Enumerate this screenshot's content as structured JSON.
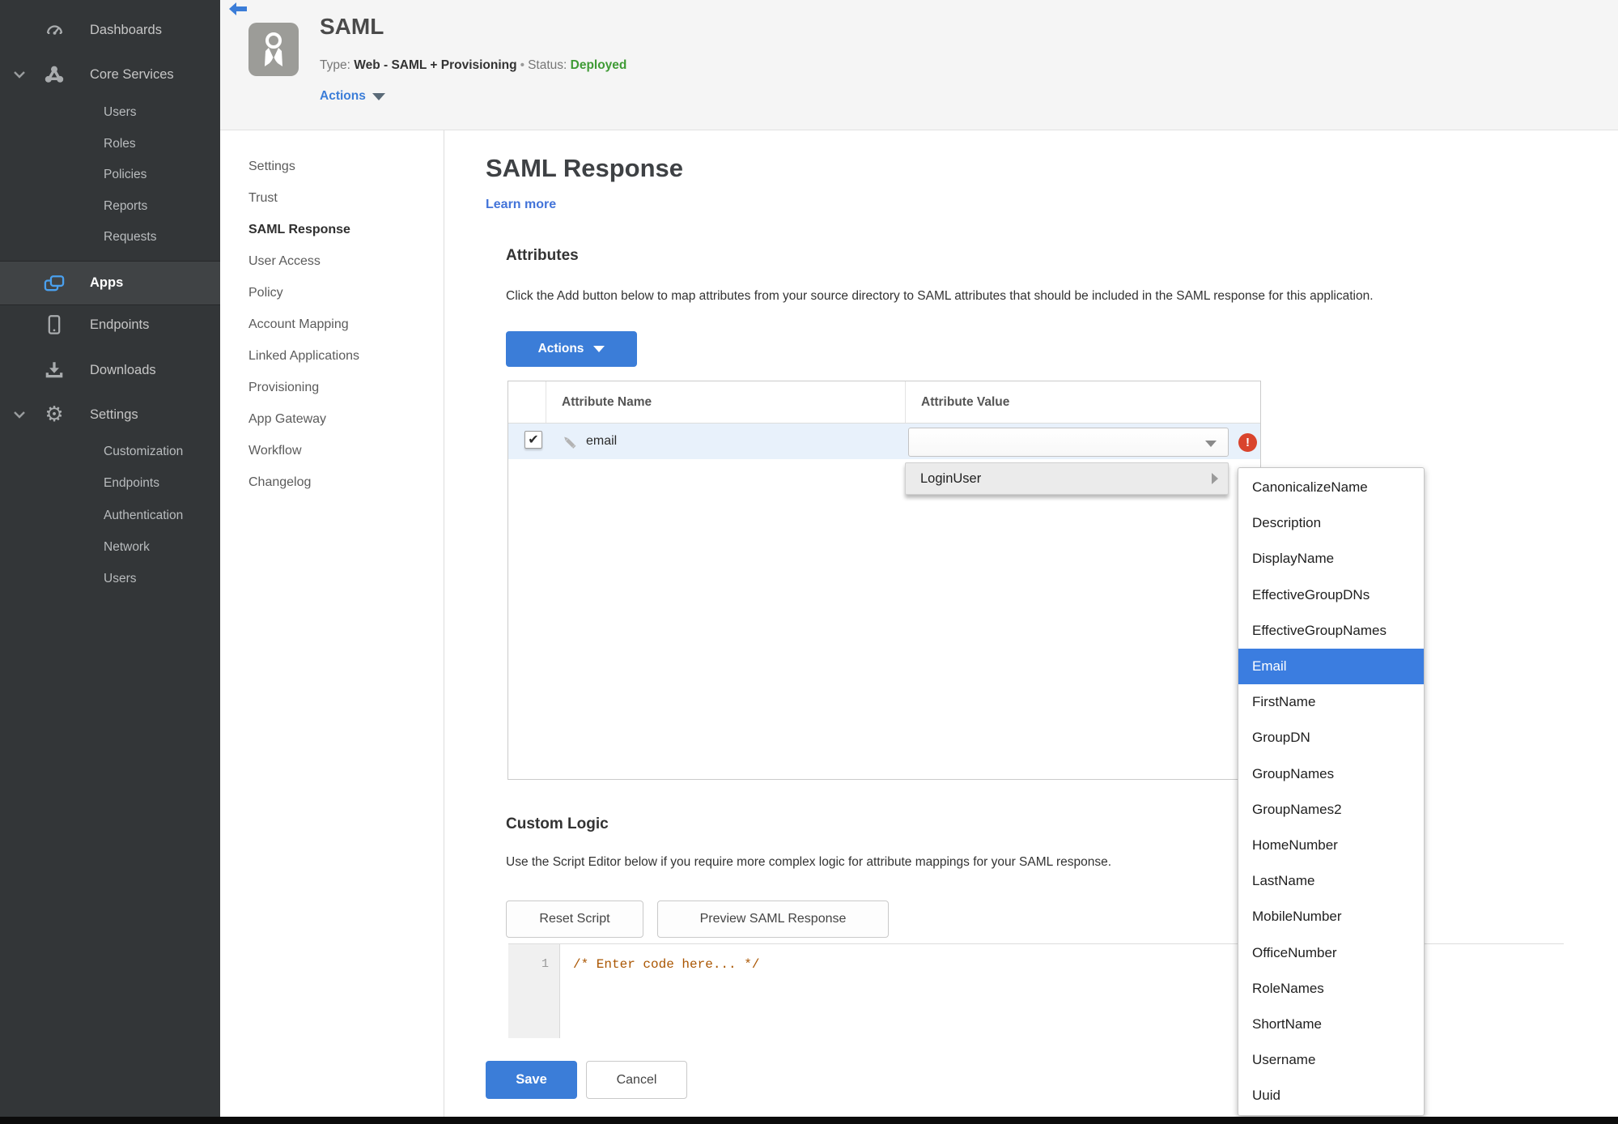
{
  "colors": {
    "accent_blue": "#3b7dd8",
    "status_green": "#3f9b35",
    "error_red": "#d9442d",
    "selected_menu_blue": "#3b7de0",
    "sidebar_bg": "#333638"
  },
  "sidebar": {
    "items": [
      {
        "label": "Dashboards",
        "icon": "gauge-icon"
      },
      {
        "label": "Core Services",
        "icon": "cluster-icon",
        "expanded": true,
        "children": [
          "Users",
          "Roles",
          "Policies",
          "Reports",
          "Requests"
        ]
      },
      {
        "label": "Apps",
        "icon": "apps-icon",
        "active": true
      },
      {
        "label": "Endpoints",
        "icon": "phone-icon"
      },
      {
        "label": "Downloads",
        "icon": "download-icon"
      },
      {
        "label": "Settings",
        "icon": "gear-icon",
        "expanded": true,
        "children": [
          "Customization",
          "Endpoints",
          "Authentication",
          "Network",
          "Users"
        ]
      }
    ]
  },
  "header": {
    "app_title": "SAML",
    "type_label": "Type:",
    "type_value": "Web - SAML + Provisioning",
    "separator": "•",
    "status_label": "Status:",
    "status_value": "Deployed",
    "actions_label": "Actions",
    "back_icon": "back-arrow-icon",
    "badge_icon": "award-ribbon-icon"
  },
  "subnav": {
    "active": "SAML Response",
    "items": [
      "Settings",
      "Trust",
      "SAML Response",
      "User Access",
      "Policy",
      "Account Mapping",
      "Linked Applications",
      "Provisioning",
      "App Gateway",
      "Workflow",
      "Changelog"
    ]
  },
  "main": {
    "title": "SAML Response",
    "learn_more": "Learn more",
    "attributes": {
      "heading": "Attributes",
      "description": "Click the Add button below to map attributes from your source directory to SAML attributes that should be included in the SAML response for this application.",
      "actions_button": "Actions",
      "table": {
        "columns": [
          "Attribute Name",
          "Attribute Value"
        ],
        "row": {
          "name": "email",
          "checked": true,
          "check_glyph": "✔",
          "value": ""
        }
      }
    },
    "custom_logic": {
      "heading": "Custom Logic",
      "description": "Use the Script Editor below if you require more complex logic for attribute mappings for your SAML response.",
      "reset_button": "Reset Script",
      "preview_button": "Preview SAML Response"
    },
    "editor": {
      "line_number": "1",
      "code": "/* Enter code here... */"
    },
    "footer": {
      "save_label": "Save",
      "cancel_label": "Cancel"
    }
  },
  "value_menu": {
    "root_item": "LoginUser",
    "error_glyph": "!",
    "selected": "Email",
    "options": [
      "CanonicalizeName",
      "Description",
      "DisplayName",
      "EffectiveGroupDNs",
      "EffectiveGroupNames",
      "Email",
      "FirstName",
      "GroupDN",
      "GroupNames",
      "GroupNames2",
      "HomeNumber",
      "LastName",
      "MobileNumber",
      "OfficeNumber",
      "RoleNames",
      "ShortName",
      "Username",
      "Uuid"
    ]
  }
}
